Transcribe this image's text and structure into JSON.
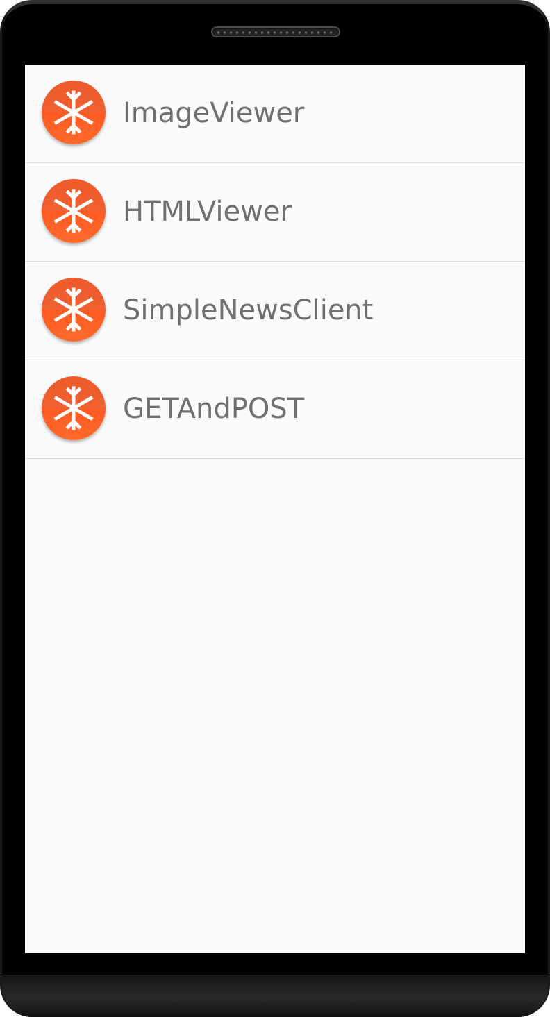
{
  "launcher": {
    "icon": "snowflake-app-icon",
    "icon_color": "#f4602b",
    "items": [
      {
        "label": "ImageViewer"
      },
      {
        "label": "HTMLViewer"
      },
      {
        "label": "SimpleNewsClient"
      },
      {
        "label": "GETAndPOST"
      }
    ]
  }
}
